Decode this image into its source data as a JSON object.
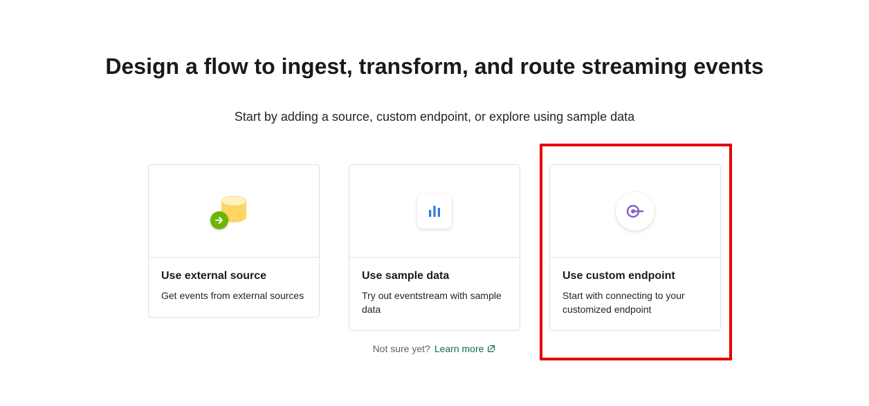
{
  "header": {
    "title": "Design a flow to ingest, transform, and route streaming events",
    "subtitle": "Start by adding a source, custom endpoint, or explore using sample data"
  },
  "cards": {
    "external": {
      "title": "Use external source",
      "desc": "Get events from external sources"
    },
    "sample": {
      "title": "Use sample data",
      "desc": "Try out eventstream with sample data"
    },
    "custom": {
      "title": "Use custom endpoint",
      "desc": "Start with connecting to your customized endpoint"
    }
  },
  "footer": {
    "not_sure": "Not sure yet?",
    "learn_more": "Learn more"
  }
}
